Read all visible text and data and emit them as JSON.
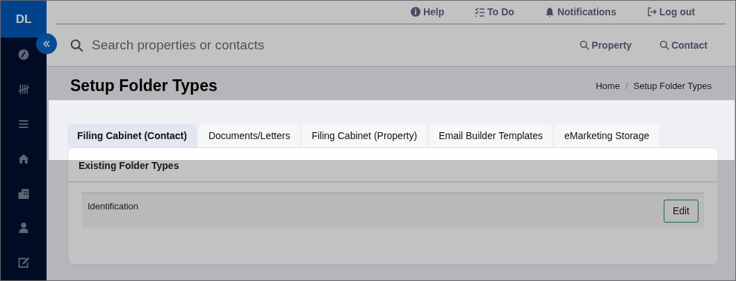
{
  "sidebar": {
    "logo": "DL"
  },
  "top_links": [
    {
      "kind": "help",
      "label": "Help"
    },
    {
      "kind": "todo",
      "label": "To Do"
    },
    {
      "kind": "bell",
      "label": "Notifications"
    },
    {
      "kind": "logout",
      "label": "Log out"
    }
  ],
  "search": {
    "placeholder": "Search properties or contacts",
    "buttons": [
      "Property",
      "Contact"
    ]
  },
  "page_title": "Setup Folder Types",
  "breadcrumb": {
    "separator": "/",
    "items": [
      "Home",
      "Setup Folder Types"
    ]
  },
  "tabs": [
    {
      "label": "Filing Cabinet (Contact)",
      "selected": true
    },
    {
      "label": "Documents/Letters",
      "selected": false
    },
    {
      "label": "Filing Cabinet (Property)",
      "selected": false
    },
    {
      "label": "Email Builder Templates",
      "selected": false
    },
    {
      "label": "eMarketing Storage",
      "selected": false
    }
  ],
  "card": {
    "title": "Existing Folder Types",
    "rows": [
      {
        "name": "Identification",
        "action": "Edit"
      }
    ]
  }
}
